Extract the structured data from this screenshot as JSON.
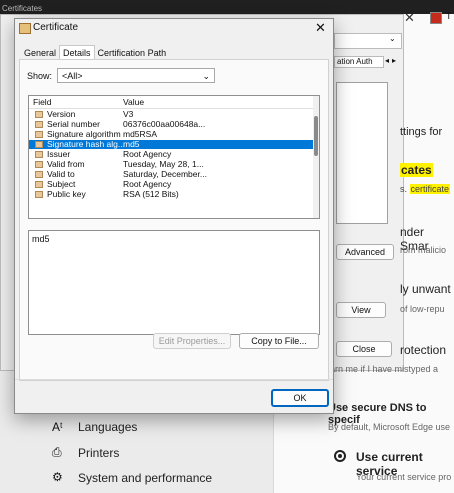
{
  "background": {
    "left_window_title": "Certificates",
    "tab_text": "T",
    "mgr_tab_label": "ation Auth",
    "settings_heading_fragment": "ttings for",
    "highlight_word": "cates",
    "cert_prefix": "s.",
    "cert_highlight": "certificate",
    "smartscreen_heading": "nder Smar",
    "smartscreen_sub": "rom malicio",
    "unwanted_heading": "ly unwant",
    "unwanted_sub": "of low-repu",
    "protection_heading": "rotection",
    "typo_text": "arn me if I have mistyped a",
    "dns_heading": "Use secure DNS to specif",
    "dns_sub": "By default, Microsoft Edge use",
    "use_current_service": "Use current service",
    "current_service_sub": "Your current service pro",
    "sidebar": [
      {
        "label": "Languages",
        "icon": "languages-icon"
      },
      {
        "label": "Printers",
        "icon": "printer-icon"
      },
      {
        "label": "System and performance",
        "icon": "system-icon"
      }
    ],
    "mgr_buttons": {
      "advanced": "Advanced",
      "view": "View",
      "close": "Close"
    }
  },
  "dialog": {
    "title": "Certificate",
    "tabs": [
      "General",
      "Details",
      "Certification Path"
    ],
    "active_tab": "Details",
    "show_label": "Show:",
    "show_value": "<All>",
    "columns": [
      "Field",
      "Value"
    ],
    "rows": [
      {
        "field": "Version",
        "value": "V3"
      },
      {
        "field": "Serial number",
        "value": "06376c00aa00648a..."
      },
      {
        "field": "Signature algorithm",
        "value": "md5RSA"
      },
      {
        "field": "Signature hash alg...",
        "value": "md5",
        "selected": true
      },
      {
        "field": "Issuer",
        "value": "Root Agency"
      },
      {
        "field": "Valid from",
        "value": "Tuesday, May 28, 1..."
      },
      {
        "field": "Valid to",
        "value": "Saturday, December..."
      },
      {
        "field": "Subject",
        "value": "Root Agency"
      },
      {
        "field": "Public key",
        "value": "RSA (512 Bits)"
      }
    ],
    "detail_value": "md5",
    "edit_properties": "Edit Properties...",
    "copy_to_file": "Copy to File...",
    "ok": "OK"
  }
}
